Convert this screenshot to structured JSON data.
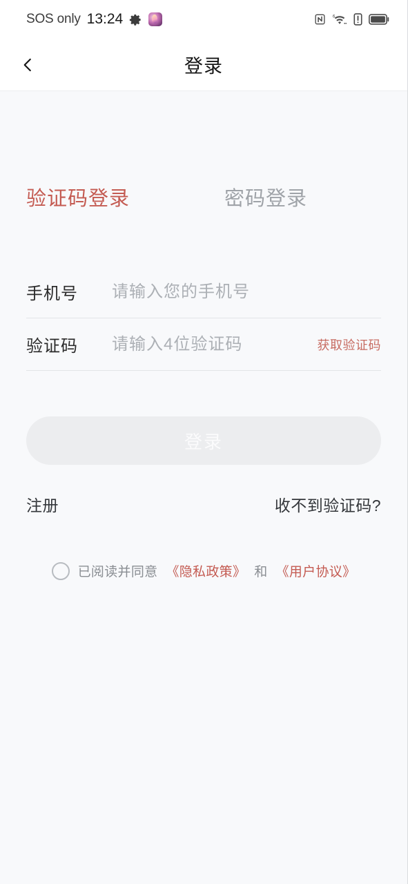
{
  "status_bar": {
    "carrier": "SOS only",
    "time": "13:24",
    "icons": {
      "gear": "gear-icon",
      "app": "app-badge-icon",
      "nfc": "nfc-icon",
      "wifi": "wifi-6-icon",
      "alert": "alert-icon",
      "battery": "battery-icon"
    }
  },
  "header": {
    "back_icon": "chevron-left-icon",
    "title": "登录"
  },
  "tabs": [
    {
      "label": "验证码登录",
      "active": true
    },
    {
      "label": "密码登录",
      "active": false
    }
  ],
  "form": {
    "phone": {
      "label": "手机号",
      "placeholder": "请输入您的手机号",
      "value": ""
    },
    "code": {
      "label": "验证码",
      "placeholder": "请输入4位验证码",
      "value": "",
      "send_button": "获取验证码"
    },
    "submit_label": "登录"
  },
  "links": {
    "register": "注册",
    "no_code": "收不到验证码?"
  },
  "agreement": {
    "checked": false,
    "prefix": "已阅读并同意",
    "privacy": "《隐私政策》",
    "conjunction": "和",
    "terms": "《用户协议》"
  },
  "colors": {
    "accent_red": "#C45B52",
    "link_red": "#C76C62",
    "page_bg": "#F8F9FB",
    "header_bg": "#FFFFFF",
    "disabled_button": "#ECEDEF",
    "divider": "#E2E4E7"
  }
}
